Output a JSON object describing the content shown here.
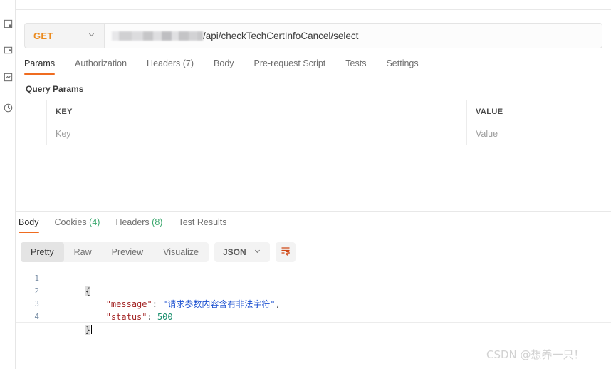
{
  "sidebar": {
    "items": [
      {
        "name": "collections-icon",
        "label": "Collections"
      },
      {
        "name": "environments-icon",
        "label": "Environments"
      },
      {
        "name": "mock-servers-icon",
        "label": "Mock Servers"
      },
      {
        "name": "history-icon",
        "label": "History"
      }
    ]
  },
  "request": {
    "method": "GET",
    "url_redacted_placeholder": "",
    "url_suffix": "/api/checkTechCertInfoCancel/select",
    "tabs": [
      {
        "label": "Params",
        "active": true
      },
      {
        "label": "Authorization",
        "active": false
      },
      {
        "label": "Headers (7)",
        "active": false
      },
      {
        "label": "Body",
        "active": false
      },
      {
        "label": "Pre-request Script",
        "active": false
      },
      {
        "label": "Tests",
        "active": false
      },
      {
        "label": "Settings",
        "active": false
      }
    ],
    "section_title": "Query Params",
    "table": {
      "headers": {
        "key": "KEY",
        "value": "VALUE"
      },
      "rows": [
        {
          "key_placeholder": "Key",
          "value_placeholder": "Value"
        }
      ]
    }
  },
  "response": {
    "tabs": [
      {
        "label": "Body",
        "count": "",
        "active": true
      },
      {
        "label": "Cookies",
        "count": "(4)",
        "active": false
      },
      {
        "label": "Headers",
        "count": "(8)",
        "active": false
      },
      {
        "label": "Test Results",
        "count": "",
        "active": false
      }
    ],
    "format_tabs": [
      {
        "label": "Pretty",
        "active": true
      },
      {
        "label": "Raw",
        "active": false
      },
      {
        "label": "Preview",
        "active": false
      },
      {
        "label": "Visualize",
        "active": false
      }
    ],
    "language": "JSON",
    "wrap_icon": "wrap-lines-icon",
    "code": {
      "line_numbers": [
        "1",
        "2",
        "3",
        "4"
      ],
      "open_brace": "{",
      "close_brace": "}",
      "entries": [
        {
          "key": "\"message\"",
          "colon": ": ",
          "value": "\"请求参数内容含有非法字符\"",
          "value_type": "string",
          "comma": ","
        },
        {
          "key": "\"status\"",
          "colon": ": ",
          "value": "500",
          "value_type": "number",
          "comma": ""
        }
      ]
    }
  },
  "watermark": "CSDN @想养一只！",
  "colors": {
    "accent": "#ef6c20",
    "method": "#eb8b1f",
    "count_green": "#3aa76d",
    "json_key": "#a52a2a",
    "json_string": "#1a4fd0",
    "json_number": "#1a8f6e",
    "gutter": "#7a8fa6"
  }
}
